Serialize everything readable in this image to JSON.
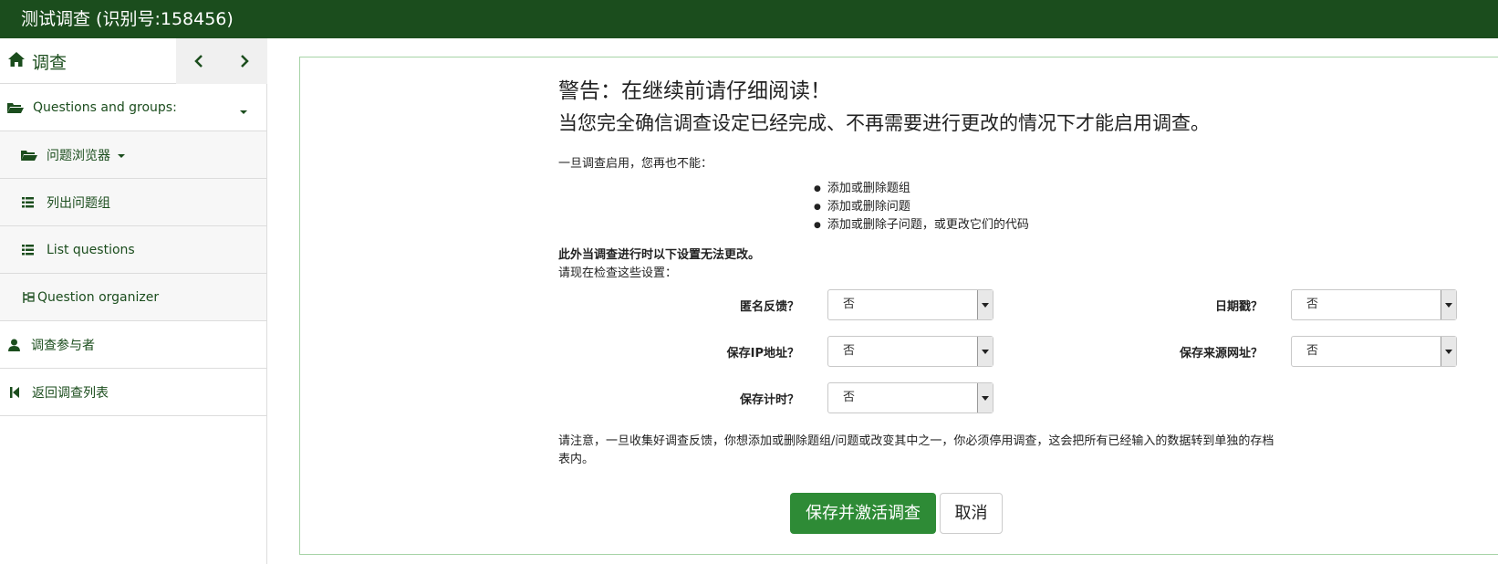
{
  "header": {
    "title": "测试调查 (识别号:158456)"
  },
  "sidebar": {
    "home_label": "调查",
    "items": [
      {
        "label": "Questions and groups:"
      },
      {
        "label": "问题浏览器"
      },
      {
        "label": "列出问题组"
      },
      {
        "label": "List questions"
      },
      {
        "label": "Question organizer"
      },
      {
        "label": "调查参与者"
      },
      {
        "label": "返回调查列表"
      }
    ]
  },
  "main": {
    "warning_title": "警告：在继续前请仔细阅读！",
    "warning_sub": "当您完全确信调查设定已经完成、不再需要进行更改的情况下才能启用调查。",
    "once_active": "一旦调查启用，您再也不能：",
    "bullets": [
      "添加或删除题组",
      "添加或删除问题",
      "添加或删除子问题，或更改它们的代码"
    ],
    "also_note": "此外当调查进行时以下设置无法更改。",
    "check_now": "请现在检查这些设置：",
    "fields": {
      "anonymized": {
        "label": "匿名反馈？",
        "value": "否"
      },
      "datestamp": {
        "label": "日期戳？",
        "value": "否"
      },
      "ipaddr": {
        "label": "保存IP地址？",
        "value": "否"
      },
      "refurl": {
        "label": "保存来源网址？",
        "value": "否"
      },
      "savetimings": {
        "label": "保存计时？",
        "value": "否"
      }
    },
    "note_line1": "请注意，一旦收集好调查反馈，你想添加或删除题组/问题或改变其中之一，你必须停用调查，这会把所有已经输入的数据转到单独的存档",
    "note_line2": "表内。",
    "save_button": "保存并激活调查",
    "cancel_button": "取消"
  },
  "colors": {
    "header_bg": "#1b4d1d",
    "primary_button": "#2e8b36",
    "panel_border": "#a6d3a6"
  }
}
